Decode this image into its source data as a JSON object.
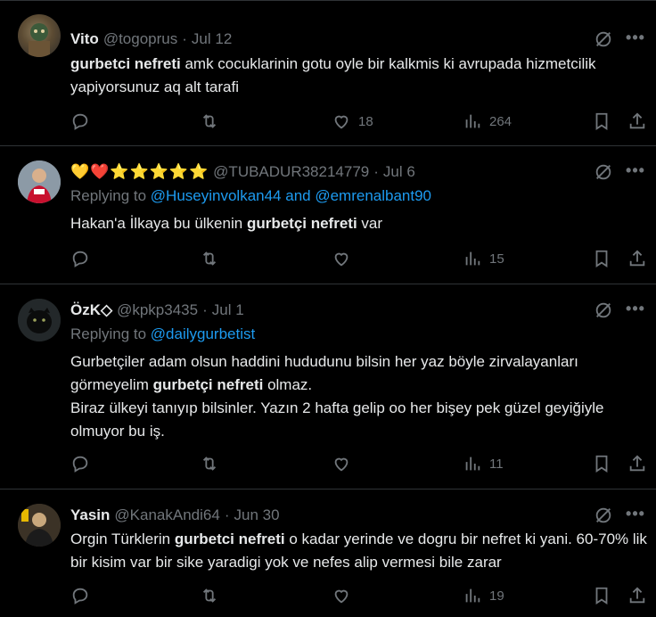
{
  "tweets": [
    {
      "name": "Vito",
      "handle": "@togoprus",
      "dot": "·",
      "date": "Jul 12",
      "text_parts": [
        "gurbetci nefreti",
        " amk cocuklarinin gotu oyle bir kalkmis ki avrupada hizmetcilik yapiyorsunuz aq alt tarafi"
      ],
      "likes": "18",
      "views": "264"
    },
    {
      "name": "💛❤️⭐⭐⭐⭐⭐",
      "handle": "@TUBADUR38214779",
      "dot": "·",
      "date": "Jul 6",
      "replying_prefix": "Replying to ",
      "replying_link1": "@Huseyinvolkan44",
      "replying_and": " and ",
      "replying_link2": "@emrenalbant90",
      "text_before": "Hakan'a İlkaya bu ülkenin  ",
      "text_bold": "gurbetçi nefreti",
      "text_after": " var",
      "views": "15"
    },
    {
      "name": "ÖzK◇",
      "handle": "@kpkp3435",
      "dot": "·",
      "date": "Jul 1",
      "replying_prefix": "Replying to ",
      "replying_link1": "@dailygurbetist",
      "line1": "Gurbetçiler adam olsun haddini hududunu bilsin her yaz böyle zirvalayanları",
      "line2_before": "görmeyelim ",
      "line2_bold": "gurbetçi nefreti",
      "line2_after": " olmaz.",
      "line3": "Biraz ülkeyi tanıyıp bilsinler. Yazın 2 hafta gelip oo her bişey pek güzel geyiğiyle olmuyor bu iş.",
      "views": "11"
    },
    {
      "name": "Yasin",
      "handle": "@KanakAndi64",
      "dot": "·",
      "date": "Jun 30",
      "text_before": "Orgin Türklerin ",
      "text_bold": "gurbetci nefreti",
      "text_after": " o kadar yerinde ve dogru bir nefret ki yani. 60-70% lik bir kisim var bir sike yaradigi yok ve nefes alip vermesi bile zarar",
      "views": "19"
    }
  ],
  "icons": [
    "reply-icon",
    "retweet-icon",
    "like-icon",
    "views-icon",
    "bookmark-icon",
    "share-icon",
    "grok-icon",
    "more-icon"
  ],
  "colors": {
    "background": "#000000",
    "text": "#e7e9ea",
    "muted": "#71767b",
    "link": "#1d9bf0",
    "divider": "#2f3336"
  }
}
